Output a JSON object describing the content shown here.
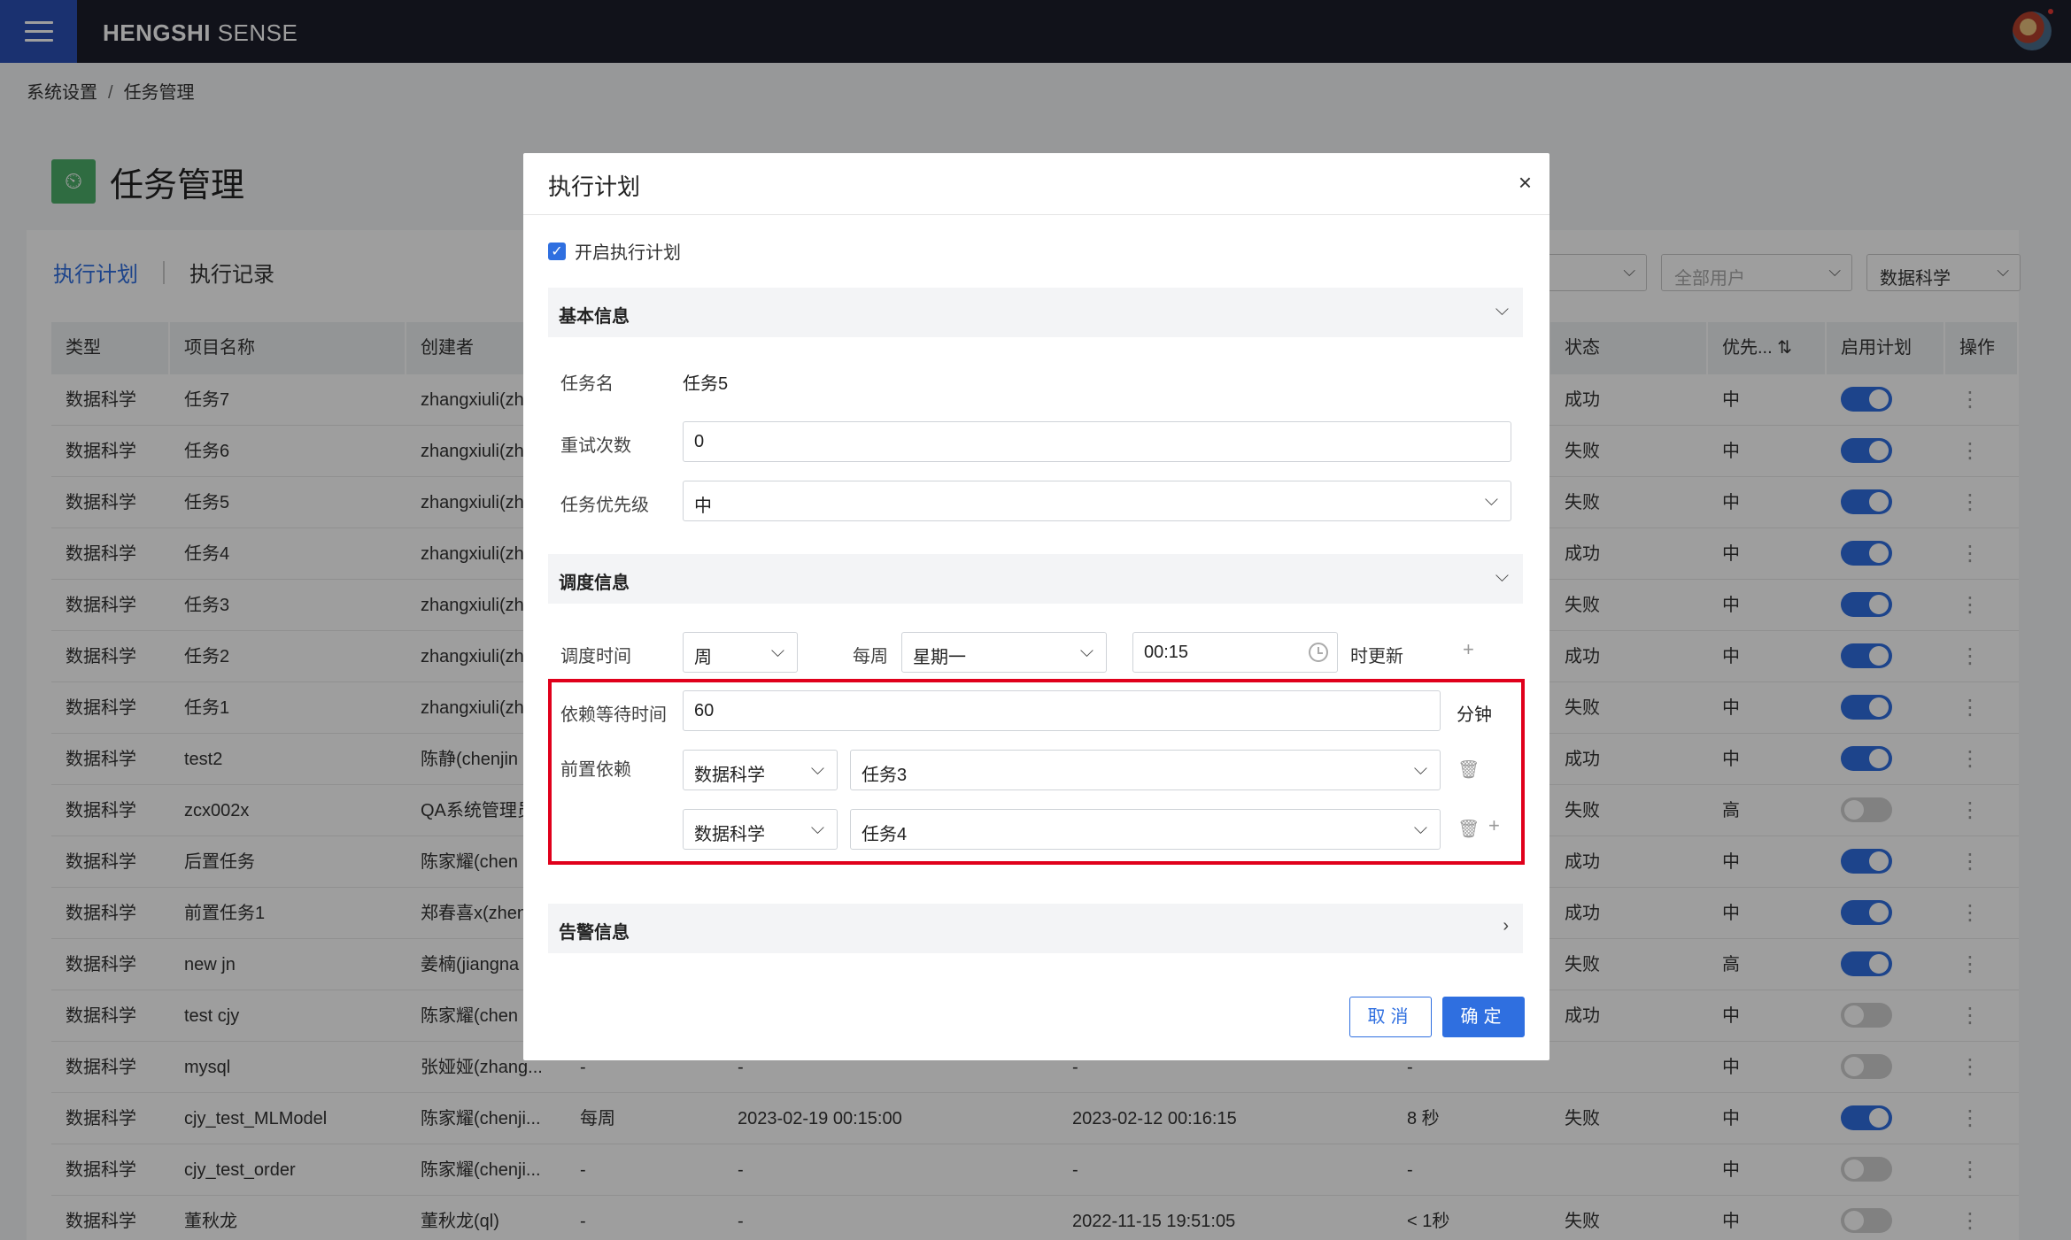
{
  "app": {
    "brand_bold": "HENGSHI",
    "brand_rest": "SENSE"
  },
  "breadcrumb": {
    "parent": "系统设置",
    "separator": "/",
    "current": "任务管理"
  },
  "page": {
    "title": "任务管理",
    "icon": "task-schedule-icon"
  },
  "tabs": [
    {
      "label": "执行计划",
      "active": true
    },
    {
      "label": "执行记录",
      "active": false
    }
  ],
  "filters": {
    "all_users": "全部用户",
    "type": "数据科学"
  },
  "table": {
    "headers": [
      "类型",
      "项目名称",
      "创建者",
      "",
      "",
      "",
      "",
      "状态",
      "优先...",
      "启用计划",
      "操作"
    ],
    "rows": [
      {
        "type": "数据科学",
        "name": "任务7",
        "creator": "zhangxiuli(zh",
        "freq": "",
        "next": "",
        "last": "",
        "duration": "",
        "status": "成功",
        "priority": "中",
        "enabled": true
      },
      {
        "type": "数据科学",
        "name": "任务6",
        "creator": "zhangxiuli(zh",
        "freq": "",
        "next": "",
        "last": "",
        "duration": "",
        "status": "失败",
        "priority": "中",
        "enabled": true
      },
      {
        "type": "数据科学",
        "name": "任务5",
        "creator": "zhangxiuli(zh",
        "freq": "",
        "next": "",
        "last": "",
        "duration": "",
        "status": "失败",
        "priority": "中",
        "enabled": true
      },
      {
        "type": "数据科学",
        "name": "任务4",
        "creator": "zhangxiuli(zh",
        "freq": "",
        "next": "",
        "last": "",
        "duration": "",
        "status": "成功",
        "priority": "中",
        "enabled": true
      },
      {
        "type": "数据科学",
        "name": "任务3",
        "creator": "zhangxiuli(zh",
        "freq": "",
        "next": "",
        "last": "",
        "duration": "",
        "status": "失败",
        "priority": "中",
        "enabled": true
      },
      {
        "type": "数据科学",
        "name": "任务2",
        "creator": "zhangxiuli(zh",
        "freq": "",
        "next": "",
        "last": "",
        "duration": "",
        "status": "成功",
        "priority": "中",
        "enabled": true
      },
      {
        "type": "数据科学",
        "name": "任务1",
        "creator": "zhangxiuli(zh",
        "freq": "",
        "next": "",
        "last": "",
        "duration": "",
        "status": "失败",
        "priority": "中",
        "enabled": true
      },
      {
        "type": "数据科学",
        "name": "test2",
        "creator": "陈静(chenjin",
        "freq": "",
        "next": "",
        "last": "",
        "duration": "",
        "status": "成功",
        "priority": "中",
        "enabled": true
      },
      {
        "type": "数据科学",
        "name": "zcx002x",
        "creator": "QA系统管理员",
        "freq": "",
        "next": "",
        "last": "",
        "duration": "",
        "status": "失败",
        "priority": "高",
        "enabled": false
      },
      {
        "type": "数据科学",
        "name": "后置任务",
        "creator": "陈家耀(chen",
        "freq": "",
        "next": "",
        "last": "",
        "duration": "",
        "status": "成功",
        "priority": "中",
        "enabled": true
      },
      {
        "type": "数据科学",
        "name": "前置任务1",
        "creator": "郑春喜x(zhen",
        "freq": "",
        "next": "",
        "last": "",
        "duration": "",
        "status": "成功",
        "priority": "中",
        "enabled": true
      },
      {
        "type": "数据科学",
        "name": "new jn",
        "creator": "姜楠(jiangna",
        "freq": "",
        "next": "",
        "last": "",
        "duration": "",
        "status": "失败",
        "priority": "高",
        "enabled": true
      },
      {
        "type": "数据科学",
        "name": "test cjy",
        "creator": "陈家耀(chen",
        "freq": "",
        "next": "",
        "last": "",
        "duration": "",
        "status": "成功",
        "priority": "中",
        "enabled": false
      },
      {
        "type": "数据科学",
        "name": "mysql",
        "creator": "张娅娅(zhang...",
        "freq": "-",
        "next": "-",
        "last": "-",
        "duration": "-",
        "status": "",
        "priority": "中",
        "enabled": false
      },
      {
        "type": "数据科学",
        "name": "cjy_test_MLModel",
        "creator": "陈家耀(chenji...",
        "freq": "每周",
        "next": "2023-02-19 00:15:00",
        "last": "2023-02-12 00:16:15",
        "duration": "8 秒",
        "status": "失败",
        "priority": "中",
        "enabled": true
      },
      {
        "type": "数据科学",
        "name": "cjy_test_order",
        "creator": "陈家耀(chenji...",
        "freq": "-",
        "next": "-",
        "last": "-",
        "duration": "-",
        "status": "",
        "priority": "中",
        "enabled": false
      },
      {
        "type": "数据科学",
        "name": "董秋龙",
        "creator": "董秋龙(ql)",
        "freq": "-",
        "next": "-",
        "last": "2022-11-15 19:51:05",
        "duration": "< 1秒",
        "status": "失败",
        "priority": "中",
        "enabled": false
      }
    ]
  },
  "modal": {
    "title": "执行计划",
    "close": "×",
    "enable_label": "开启执行计划",
    "enable_checked": true,
    "basic_section": "基本信息",
    "task_name_label": "任务名",
    "task_name_value": "任务5",
    "retry_label": "重试次数",
    "retry_value": "0",
    "priority_label": "任务优先级",
    "priority_value": "中",
    "schedule_section": "调度信息",
    "schedule_time_label": "调度时间",
    "period_value": "周",
    "every_week_label": "每周",
    "weekday_value": "星期一",
    "time_value": "00:15",
    "update_suffix": "时更新",
    "wait_label": "依赖等待时间",
    "wait_value": "60",
    "wait_unit": "分钟",
    "dependency_label": "前置依赖",
    "dependencies": [
      {
        "type": "数据科学",
        "task": "任务3"
      },
      {
        "type": "数据科学",
        "task": "任务4"
      }
    ],
    "alert_section": "告警信息",
    "cancel_label": "取消",
    "ok_label": "确定"
  },
  "colors": {
    "accent": "#2f6fe0",
    "highlight": "#e0001b",
    "topbar": "#1c1d2b",
    "menu": "#2a4fb5"
  }
}
